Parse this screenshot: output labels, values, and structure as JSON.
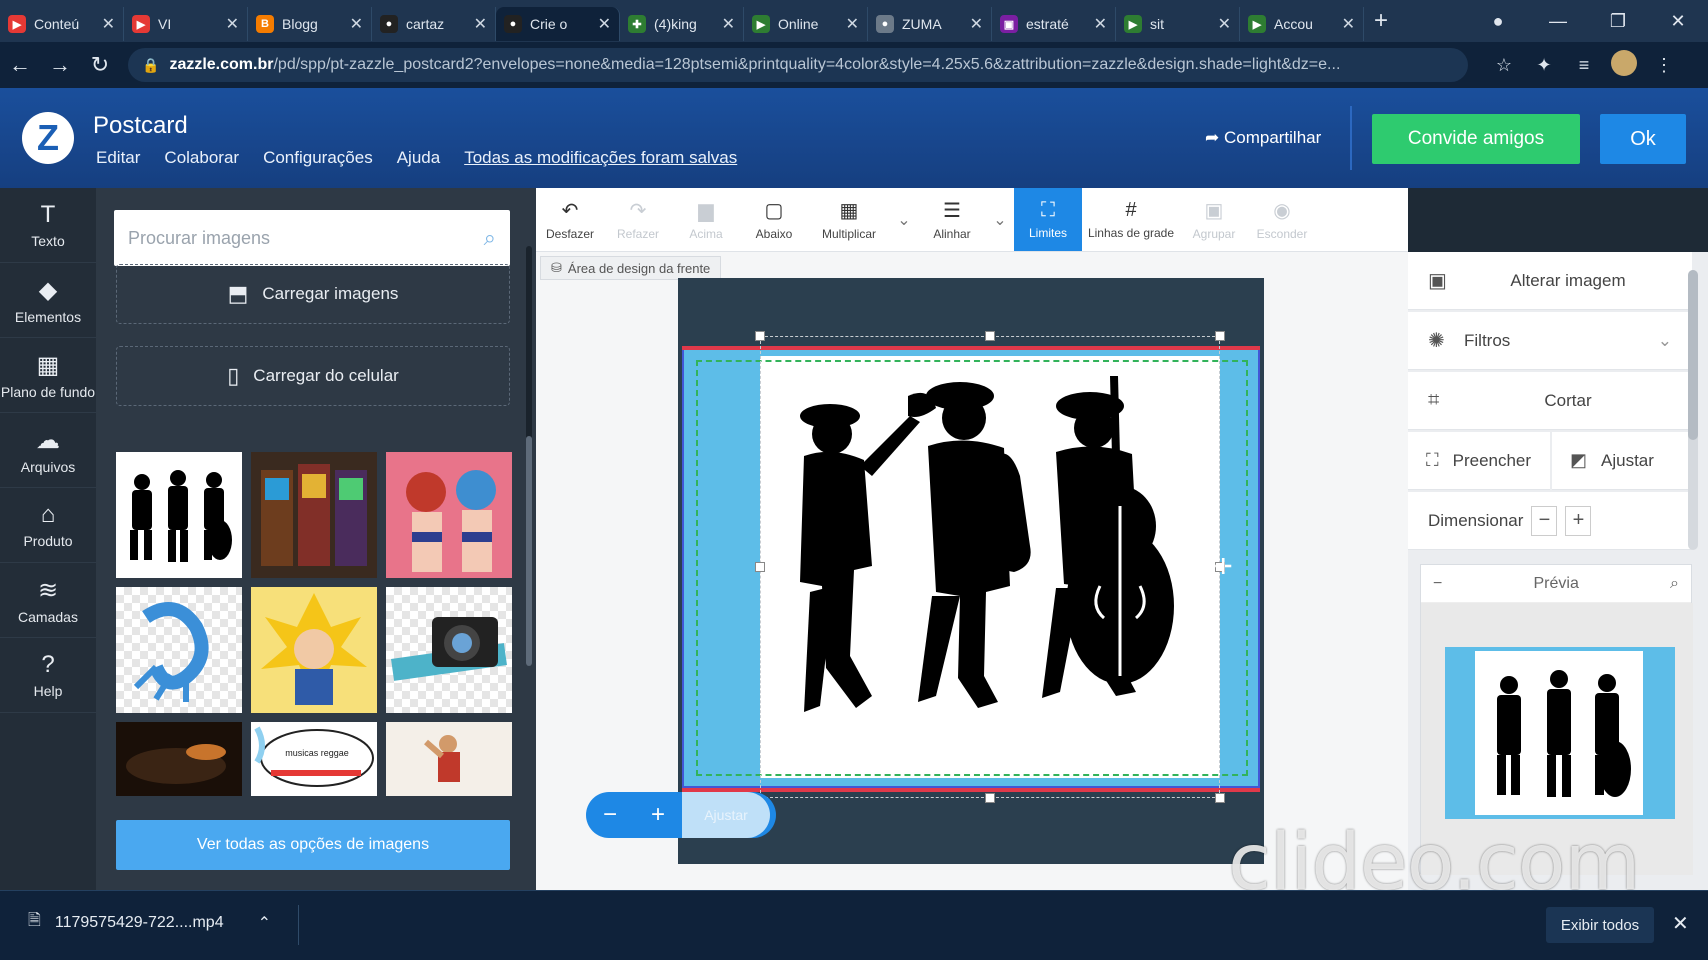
{
  "browser": {
    "tabs": [
      {
        "title": "Conteú",
        "color": "#e53935",
        "glyph": "▶"
      },
      {
        "title": "VI",
        "color": "#e53935",
        "glyph": "▶"
      },
      {
        "title": "Blogg",
        "color": "#f57c00",
        "glyph": "B"
      },
      {
        "title": "cartaz",
        "color": "#222222",
        "glyph": "●"
      },
      {
        "title": "Crie o",
        "color": "#222222",
        "glyph": "●"
      },
      {
        "title": "(4)king",
        "color": "#2e7d32",
        "glyph": "✚"
      },
      {
        "title": "Online",
        "color": "#2e7d32",
        "glyph": "▶"
      },
      {
        "title": "ZUMA",
        "color": "#6c7a89",
        "glyph": "●"
      },
      {
        "title": "estraté",
        "color": "#7b1fa2",
        "glyph": "▣"
      },
      {
        "title": "sit",
        "color": "#2e7d32",
        "glyph": "▶"
      },
      {
        "title": "Accou",
        "color": "#2e7d32",
        "glyph": "▶"
      }
    ],
    "url_domain": "zazzle.com.br",
    "url_rest": "/pd/spp/pt-zazzle_postcard2?envelopes=none&media=128ptsemi&printquality=4color&style=4.25x5.6&zattribution=zazzle&design.shade=light&dz=e..."
  },
  "header": {
    "logo": "Z",
    "title": "Postcard",
    "menu": [
      "Editar",
      "Colaborar",
      "Configurações",
      "Ajuda"
    ],
    "saved_status": "Todas as modificações foram salvas",
    "share_label": "Compartilhar",
    "invite_label": "Convide amigos",
    "ok_label": "Ok"
  },
  "left_tools": [
    {
      "label": "Texto",
      "icon": "T"
    },
    {
      "label": "Elementos",
      "icon": "◆"
    },
    {
      "label": "Plano de fundo",
      "icon": "▦"
    },
    {
      "label": "Arquivos",
      "icon": "☁"
    },
    {
      "label": "Produto",
      "icon": "⌂"
    },
    {
      "label": "Camadas",
      "icon": "≋"
    },
    {
      "label": "Help",
      "icon": "?"
    }
  ],
  "image_panel": {
    "search_placeholder": "Procurar imagens",
    "upload_label": "Carregar imagens",
    "upload_phone_label": "Carregar do celular",
    "see_all_label": "Ver todas as opções de imagens",
    "thumb_text": "musicas reggae"
  },
  "canvas_toolbar": [
    {
      "label": "Desfazer",
      "icon": "↶",
      "state": "normal"
    },
    {
      "label": "Refazer",
      "icon": "↷",
      "state": "disabled"
    },
    {
      "label": "Acima",
      "icon": "▆",
      "state": "disabled"
    },
    {
      "label": "Abaixo",
      "icon": "▢",
      "state": "normal"
    },
    {
      "label": "Multiplicar",
      "icon": "▦",
      "state": "normal"
    },
    {
      "label": "Alinhar",
      "icon": "☰",
      "state": "normal"
    },
    {
      "label": "Limites",
      "icon": "⛶",
      "state": "active"
    },
    {
      "label": "Linhas de grade",
      "icon": "#",
      "state": "normal"
    },
    {
      "label": "Agrupar",
      "icon": "▣",
      "state": "disabled"
    },
    {
      "label": "Esconder",
      "icon": "◉",
      "state": "disabled"
    }
  ],
  "canvas": {
    "design_area_label": "Área de design da frente",
    "zoom_minus": "−",
    "zoom_plus": "+",
    "fit_label": "Ajustar"
  },
  "right_panel": {
    "change_image": "Alterar imagem",
    "filters": "Filtros",
    "crop": "Cortar",
    "fill": "Preencher",
    "fit": "Ajustar",
    "resize": "Dimensionar",
    "preview_label": "Prévia"
  },
  "watermark": "clideo.com",
  "download_bar": {
    "filename": "1179575429-722....mp4",
    "show_all": "Exibir todos"
  }
}
